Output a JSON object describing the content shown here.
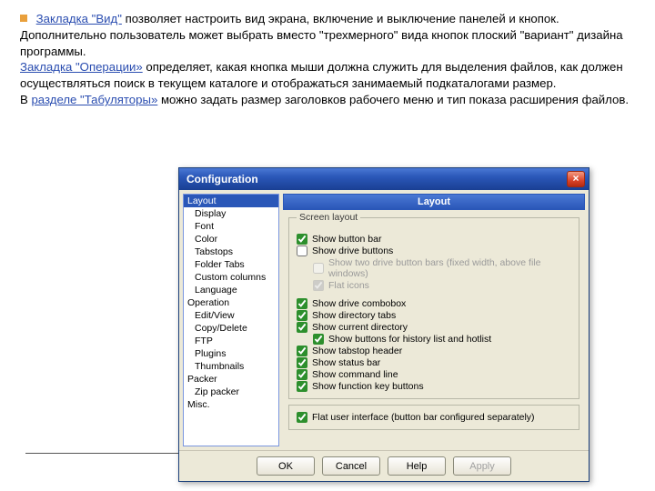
{
  "intro": {
    "p1_link": "Закладка \"Вид\"",
    "p1_rest": " позволяет настроить вид экрана, включение и выключение панелей и кнопок. Дополнительно пользователь может выбрать вместо \"трехмерного\" вида кнопок плоский \"вариант\" дизайна программы.",
    "p2_link": "Закладка \"Операции»",
    "p2_rest": " определяет, какая кнопка мыши должна служить для выделения файлов, как должен осуществляться поиск в текущем каталоге и отображаться занимаемый подкаталогами размер.",
    "p3_pre": " В ",
    "p3_link": "разделе \"Табуляторы»",
    "p3_rest": " можно задать размер заголовков рабочего меню и тип показа расширения файлов."
  },
  "dialog": {
    "title": "Configuration",
    "panel_title": "Layout",
    "tree": [
      {
        "l": "Layout",
        "sel": true,
        "top": true
      },
      {
        "l": "Display"
      },
      {
        "l": "Font"
      },
      {
        "l": "Color"
      },
      {
        "l": "Tabstops"
      },
      {
        "l": "Folder Tabs"
      },
      {
        "l": "Custom columns"
      },
      {
        "l": "Language"
      },
      {
        "l": "Operation",
        "top": true
      },
      {
        "l": "Edit/View"
      },
      {
        "l": "Copy/Delete"
      },
      {
        "l": "FTP"
      },
      {
        "l": "Plugins"
      },
      {
        "l": "Thumbnails"
      },
      {
        "l": "Packer",
        "top": true
      },
      {
        "l": "Zip packer"
      },
      {
        "l": "Misc.",
        "top": true
      }
    ],
    "group1": {
      "legend": "Screen layout",
      "c1": "Show button bar",
      "c2": "Show drive buttons",
      "c2a": "Show two drive button bars (fixed width, above file windows)",
      "c2b": "Flat icons",
      "c3": "Show drive combobox",
      "c4": "Show directory tabs",
      "c5": "Show current directory",
      "c5a": "Show buttons for history list and hotlist",
      "c6": "Show tabstop header",
      "c7": "Show status bar",
      "c8": "Show command line",
      "c9": "Show function key buttons"
    },
    "group2": {
      "c1": "Flat user interface (button bar configured separately)"
    },
    "buttons": {
      "ok": "OK",
      "cancel": "Cancel",
      "help": "Help",
      "apply": "Apply"
    }
  }
}
